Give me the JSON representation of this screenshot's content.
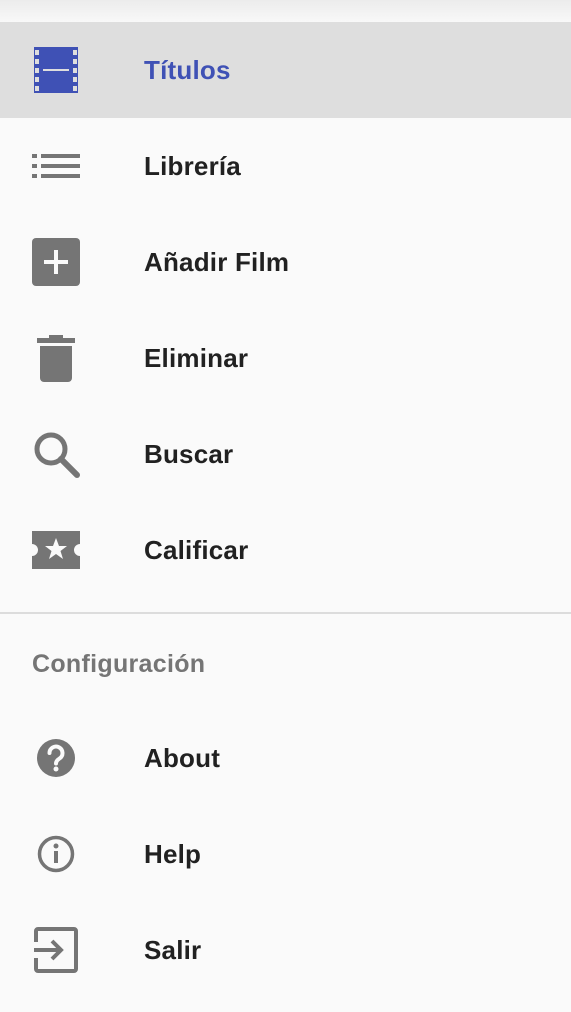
{
  "colors": {
    "accent": "#3f51b5",
    "icon_gray": "#757575",
    "selected_bg": "#dedede",
    "text": "#212121"
  },
  "menu": {
    "items": [
      {
        "label": "Títulos",
        "icon": "movie-film-icon",
        "selected": true
      },
      {
        "label": "Librería",
        "icon": "list-icon",
        "selected": false
      },
      {
        "label": "Añadir Film",
        "icon": "add-box-icon",
        "selected": false
      },
      {
        "label": "Eliminar",
        "icon": "trash-icon",
        "selected": false
      },
      {
        "label": "Buscar",
        "icon": "search-icon",
        "selected": false
      },
      {
        "label": "Calificar",
        "icon": "rate-ticket-star-icon",
        "selected": false
      }
    ]
  },
  "settings": {
    "header": "Configuración",
    "items": [
      {
        "label": "About",
        "icon": "help-circle-icon"
      },
      {
        "label": "Help",
        "icon": "info-outline-icon"
      },
      {
        "label": "Salir",
        "icon": "exit-icon"
      }
    ]
  }
}
